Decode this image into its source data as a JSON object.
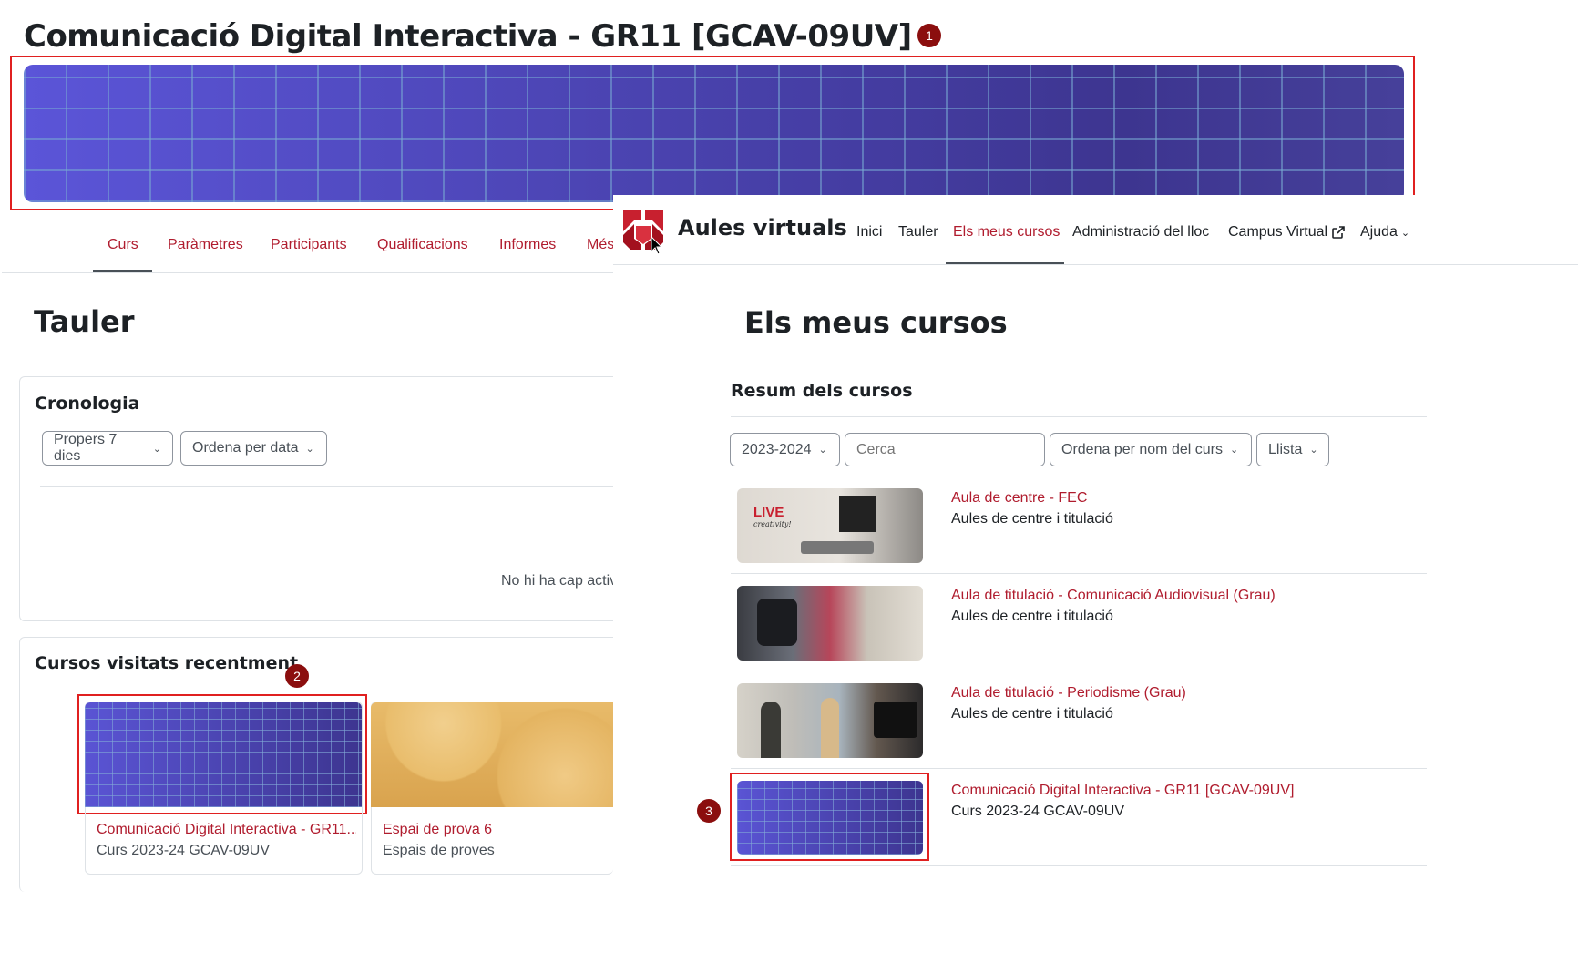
{
  "course_title": "Comunicació Digital Interactiva - GR11 [GCAV-09UV]",
  "callouts": {
    "c1": "1",
    "c2": "2",
    "c3": "3"
  },
  "course_tabs": [
    {
      "label": "Curs",
      "active": true
    },
    {
      "label": "Paràmetres"
    },
    {
      "label": "Participants"
    },
    {
      "label": "Qualificacions"
    },
    {
      "label": "Informes"
    },
    {
      "label": "Més"
    }
  ],
  "brand": {
    "name": "Aules virtuals",
    "accent": "#b01c2e"
  },
  "topnav": {
    "items": [
      "Inici",
      "Tauler",
      "Els meus cursos",
      "Administració del lloc",
      "Campus Virtual",
      "Ajuda"
    ],
    "active": "Els meus cursos"
  },
  "dashboard": {
    "title": "Tauler",
    "timeline": {
      "title": "Cronologia",
      "filter": "Propers 7 dies",
      "sort": "Ordena per data",
      "empty": "No hi ha cap activ"
    },
    "recent": {
      "title": "Cursos visitats recentment",
      "cards": [
        {
          "name": "Comunicació Digital Interactiva - GR11...",
          "sub": "Curs 2023-24 GCAV-09UV"
        },
        {
          "name": "Espai de prova 6",
          "sub": "Espais de proves"
        }
      ]
    }
  },
  "mycourses": {
    "title": "Els meus cursos",
    "overview_title": "Resum dels cursos",
    "filters": {
      "year": "2023-2024",
      "search_placeholder": "Cerca",
      "sort": "Ordena per nom del curs",
      "view": "Llista"
    },
    "courses": [
      {
        "name": "Aula de centre - FEC",
        "sub": "Aules de centre i titulació"
      },
      {
        "name": "Aula de titulació - Comunicació Audiovisual (Grau)",
        "sub": "Aules de centre i titulació"
      },
      {
        "name": "Aula de titulació - Periodisme (Grau)",
        "sub": "Aules de centre i titulació"
      },
      {
        "name": "Comunicació Digital Interactiva - GR11 [GCAV-09UV]",
        "sub": "Curs 2023-24 GCAV-09UV"
      }
    ]
  },
  "thumb_text": {
    "live": "LIVE",
    "creativity": "creativity!"
  }
}
